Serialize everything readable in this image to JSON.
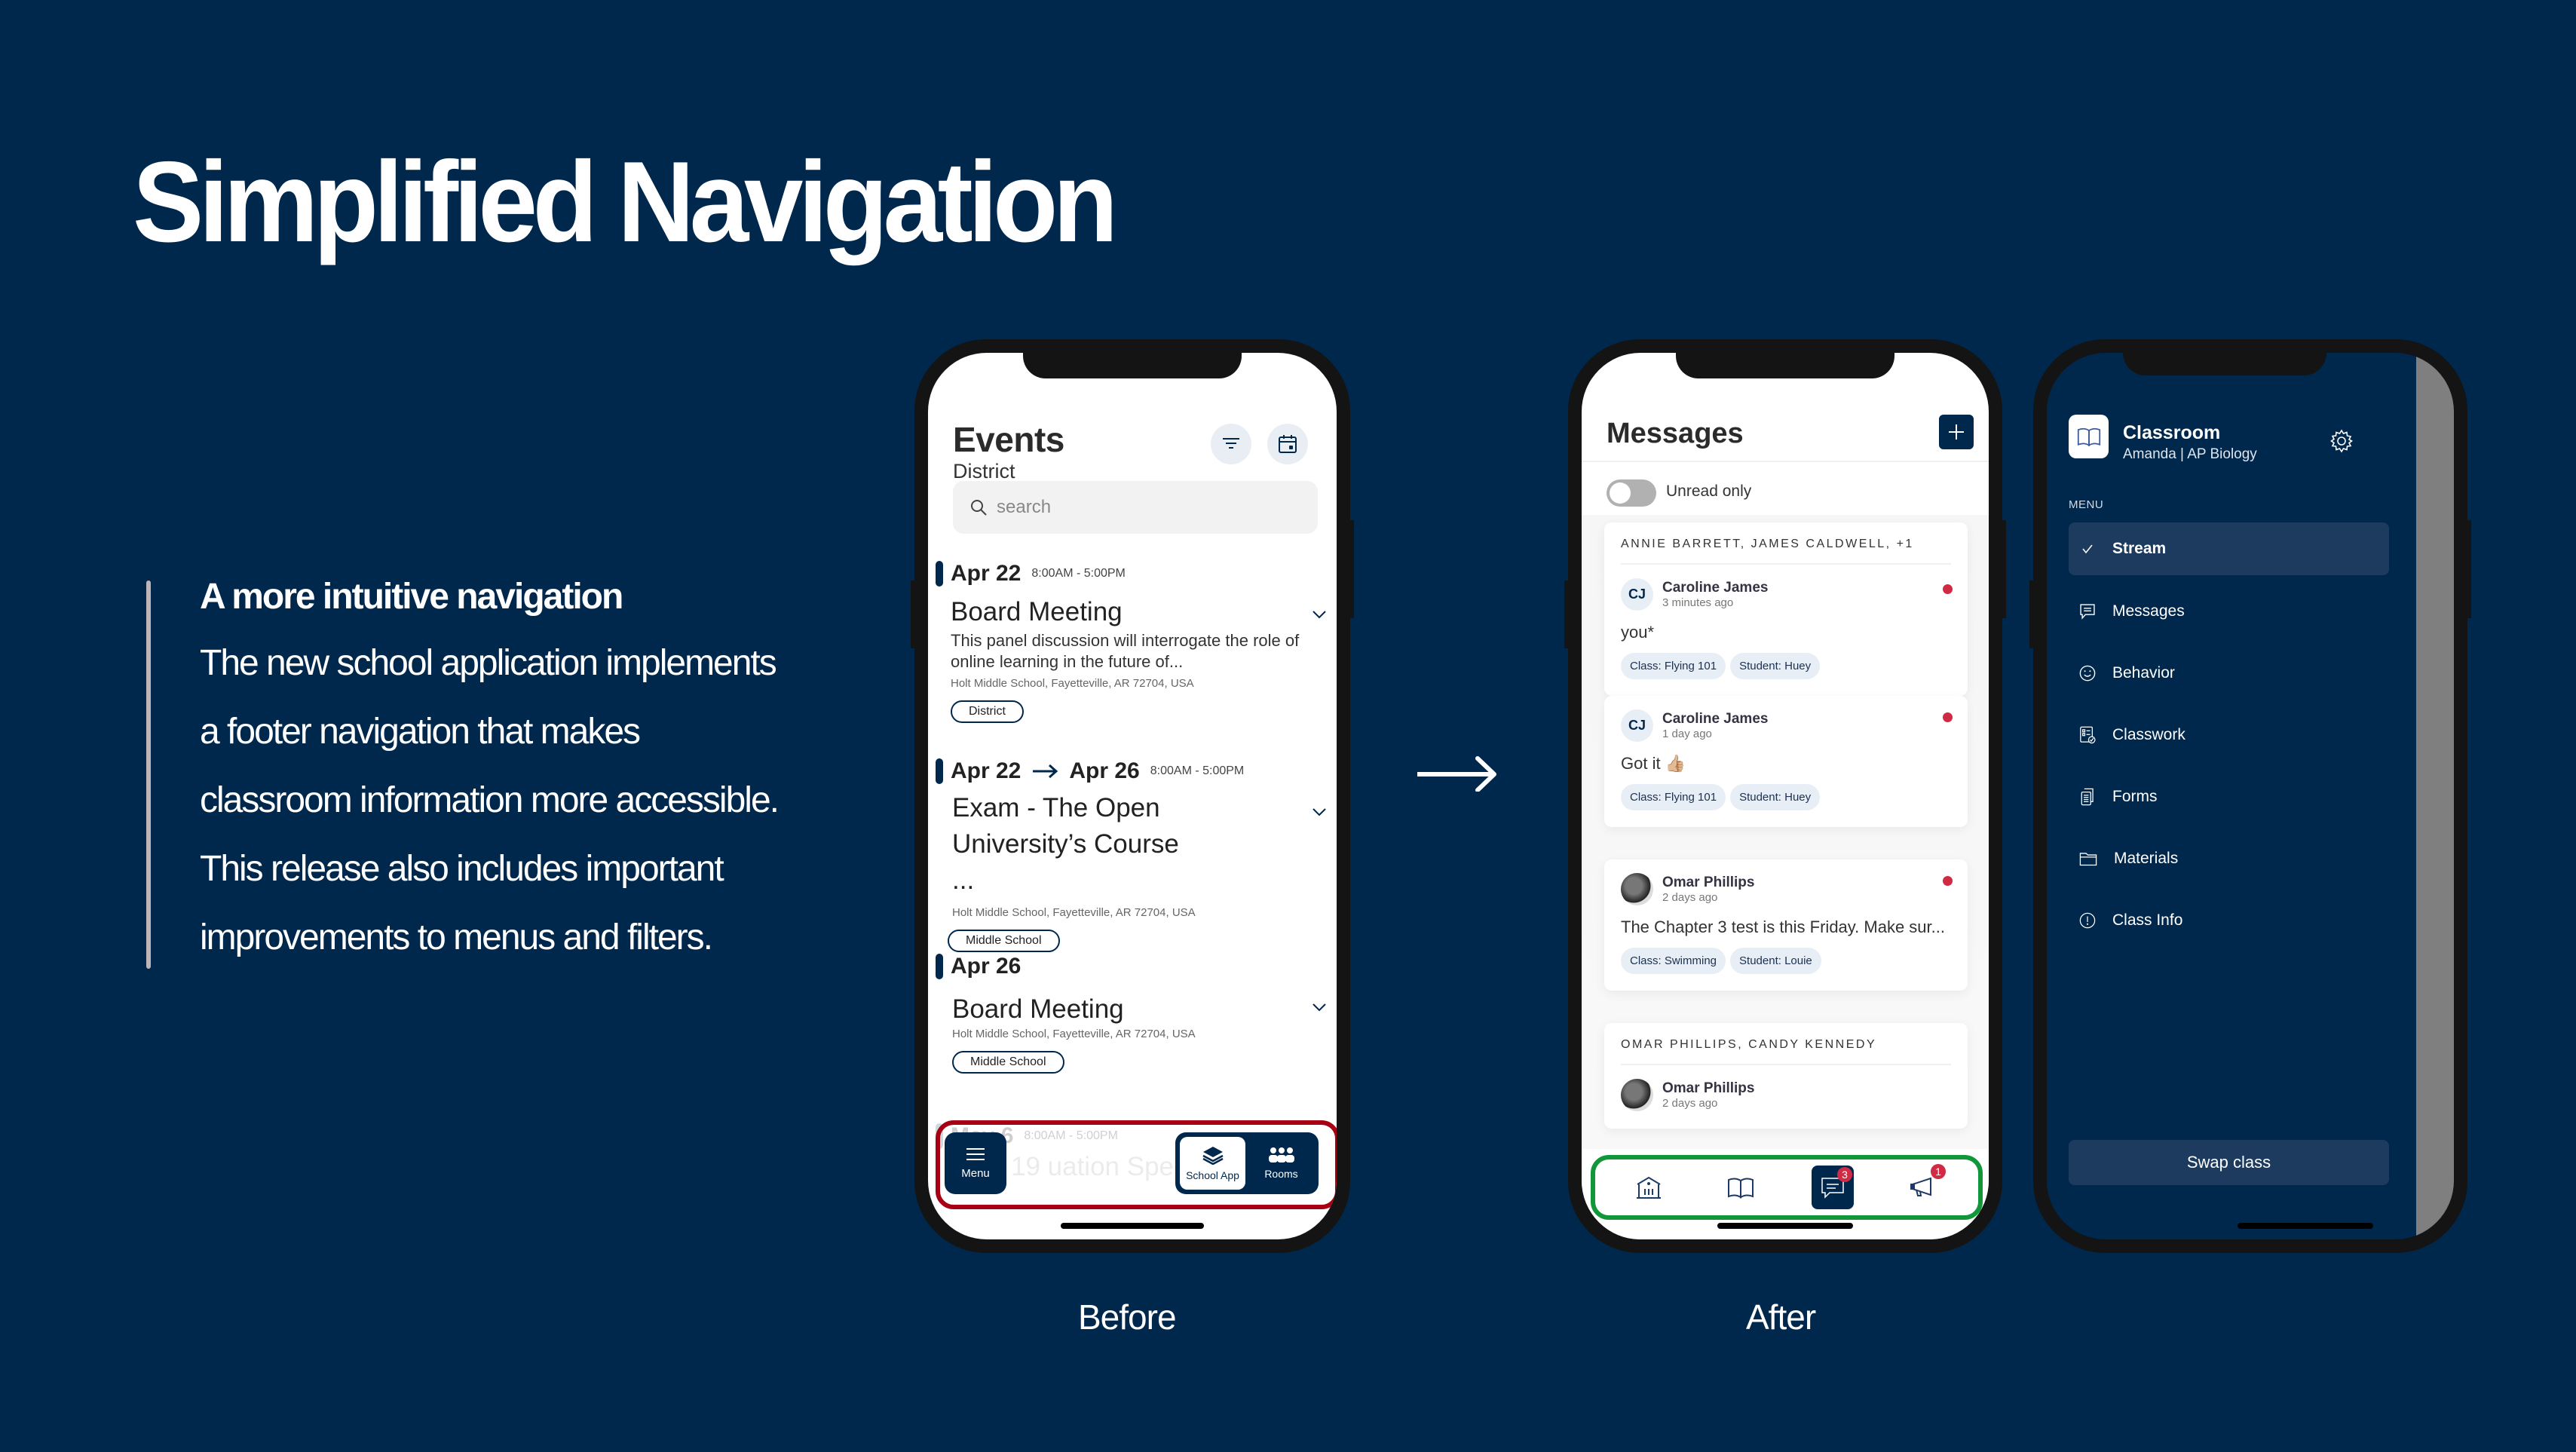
{
  "slide": {
    "title": "Simplified Navigation",
    "feature_heading": "A more intuitive navigation",
    "feature_lines": [
      "The new school application implements",
      "a footer navigation that makes",
      "classroom information more accessible.",
      "This release also includes important",
      "improvements to menus and filters."
    ],
    "before_label": "Before",
    "after_label": "After",
    "arrow_icon": "arrow-right-icon"
  },
  "colors": {
    "background": "#00284d",
    "brand_navy": "#00284d",
    "before_highlight": "#a70014",
    "after_highlight": "#11963a",
    "unread_dot": "#d12a45"
  },
  "before_screen": {
    "title": "Events",
    "subtitle": "District",
    "filter_icon": "filter-icon",
    "calendar_icon": "calendar-icon",
    "search_placeholder": "search",
    "events": [
      {
        "date": "Apr 22",
        "end_date": "",
        "time": "8:00AM  -  5:00PM",
        "name": "Board Meeting",
        "description": "This panel discussion will interrogate the role of online learning in the future of...",
        "location": "Holt Middle School, Fayetteville, AR 72704, USA",
        "tag": "District"
      },
      {
        "date": "Apr 22",
        "end_date": "Apr 26",
        "time": "8:00AM  -  5:00PM",
        "name": "Exam - The Open University’s Course ...",
        "description": "",
        "location": "Holt Middle School, Fayetteville, AR 72704, USA",
        "tag": "Middle School"
      },
      {
        "date": "Apr 26",
        "end_date": "",
        "time": "",
        "name": "Board Meeting",
        "description": "",
        "location": "Holt Middle School, Fayetteville, AR 72704, USA",
        "tag": "Middle School"
      }
    ],
    "faded_event": {
      "date": "May 6",
      "time": "8:00AM  -  5:00PM",
      "name_fragment": "19  uation Speech"
    },
    "nav": {
      "menu_label": "Menu",
      "school_app_label": "School App",
      "rooms_label": "Rooms"
    }
  },
  "after_screen": {
    "title": "Messages",
    "new_message_icon": "plus-icon",
    "unread_toggle_label": "Unread only",
    "unread_toggle_on": false,
    "threads": [
      {
        "group": "ANNIE BARRETT, JAMES CALDWELL, +1",
        "sender": "Caroline James",
        "initials": "CJ",
        "time": "3 minutes ago",
        "body": "you*",
        "unread": true,
        "tags": [
          "Class: Flying 101",
          "Student: Huey"
        ]
      },
      {
        "group": "",
        "sender": "Caroline James",
        "initials": "CJ",
        "time": "1 day ago",
        "body": "Got it 👍🏼",
        "unread": true,
        "tags": [
          "Class: Flying 101",
          "Student: Huey"
        ]
      },
      {
        "group": "",
        "sender": "Omar Phillips",
        "initials": "",
        "time": "2 days ago",
        "body": "The Chapter 3 test is this Friday. Make sur...",
        "unread": true,
        "tags": [
          "Class: Swimming",
          "Student: Louie"
        ]
      },
      {
        "group": "OMAR PHILLIPS, CANDY KENNEDY",
        "sender": "Omar Phillips",
        "initials": "",
        "time": "2 days ago",
        "body": "",
        "unread": false,
        "tags": []
      }
    ],
    "tabs": [
      {
        "icon": "school-building-icon",
        "badge": ""
      },
      {
        "icon": "book-icon",
        "badge": ""
      },
      {
        "icon": "messages-icon",
        "badge": "3",
        "active": true
      },
      {
        "icon": "megaphone-icon",
        "badge": "1"
      }
    ]
  },
  "drawer_screen": {
    "title": "Classroom",
    "subtitle": "Amanda | AP Biology",
    "settings_icon": "gear-icon",
    "menu_heading": "MENU",
    "items": [
      {
        "label": "Stream",
        "icon": "check-icon",
        "active": true
      },
      {
        "label": "Messages",
        "icon": "message-icon"
      },
      {
        "label": "Behavior",
        "icon": "smiley-icon"
      },
      {
        "label": "Classwork",
        "icon": "classwork-icon"
      },
      {
        "label": "Forms",
        "icon": "forms-icon"
      },
      {
        "label": "Materials",
        "icon": "folder-icon"
      },
      {
        "label": "Class Info",
        "icon": "info-icon"
      }
    ],
    "swap_button": "Swap class"
  }
}
